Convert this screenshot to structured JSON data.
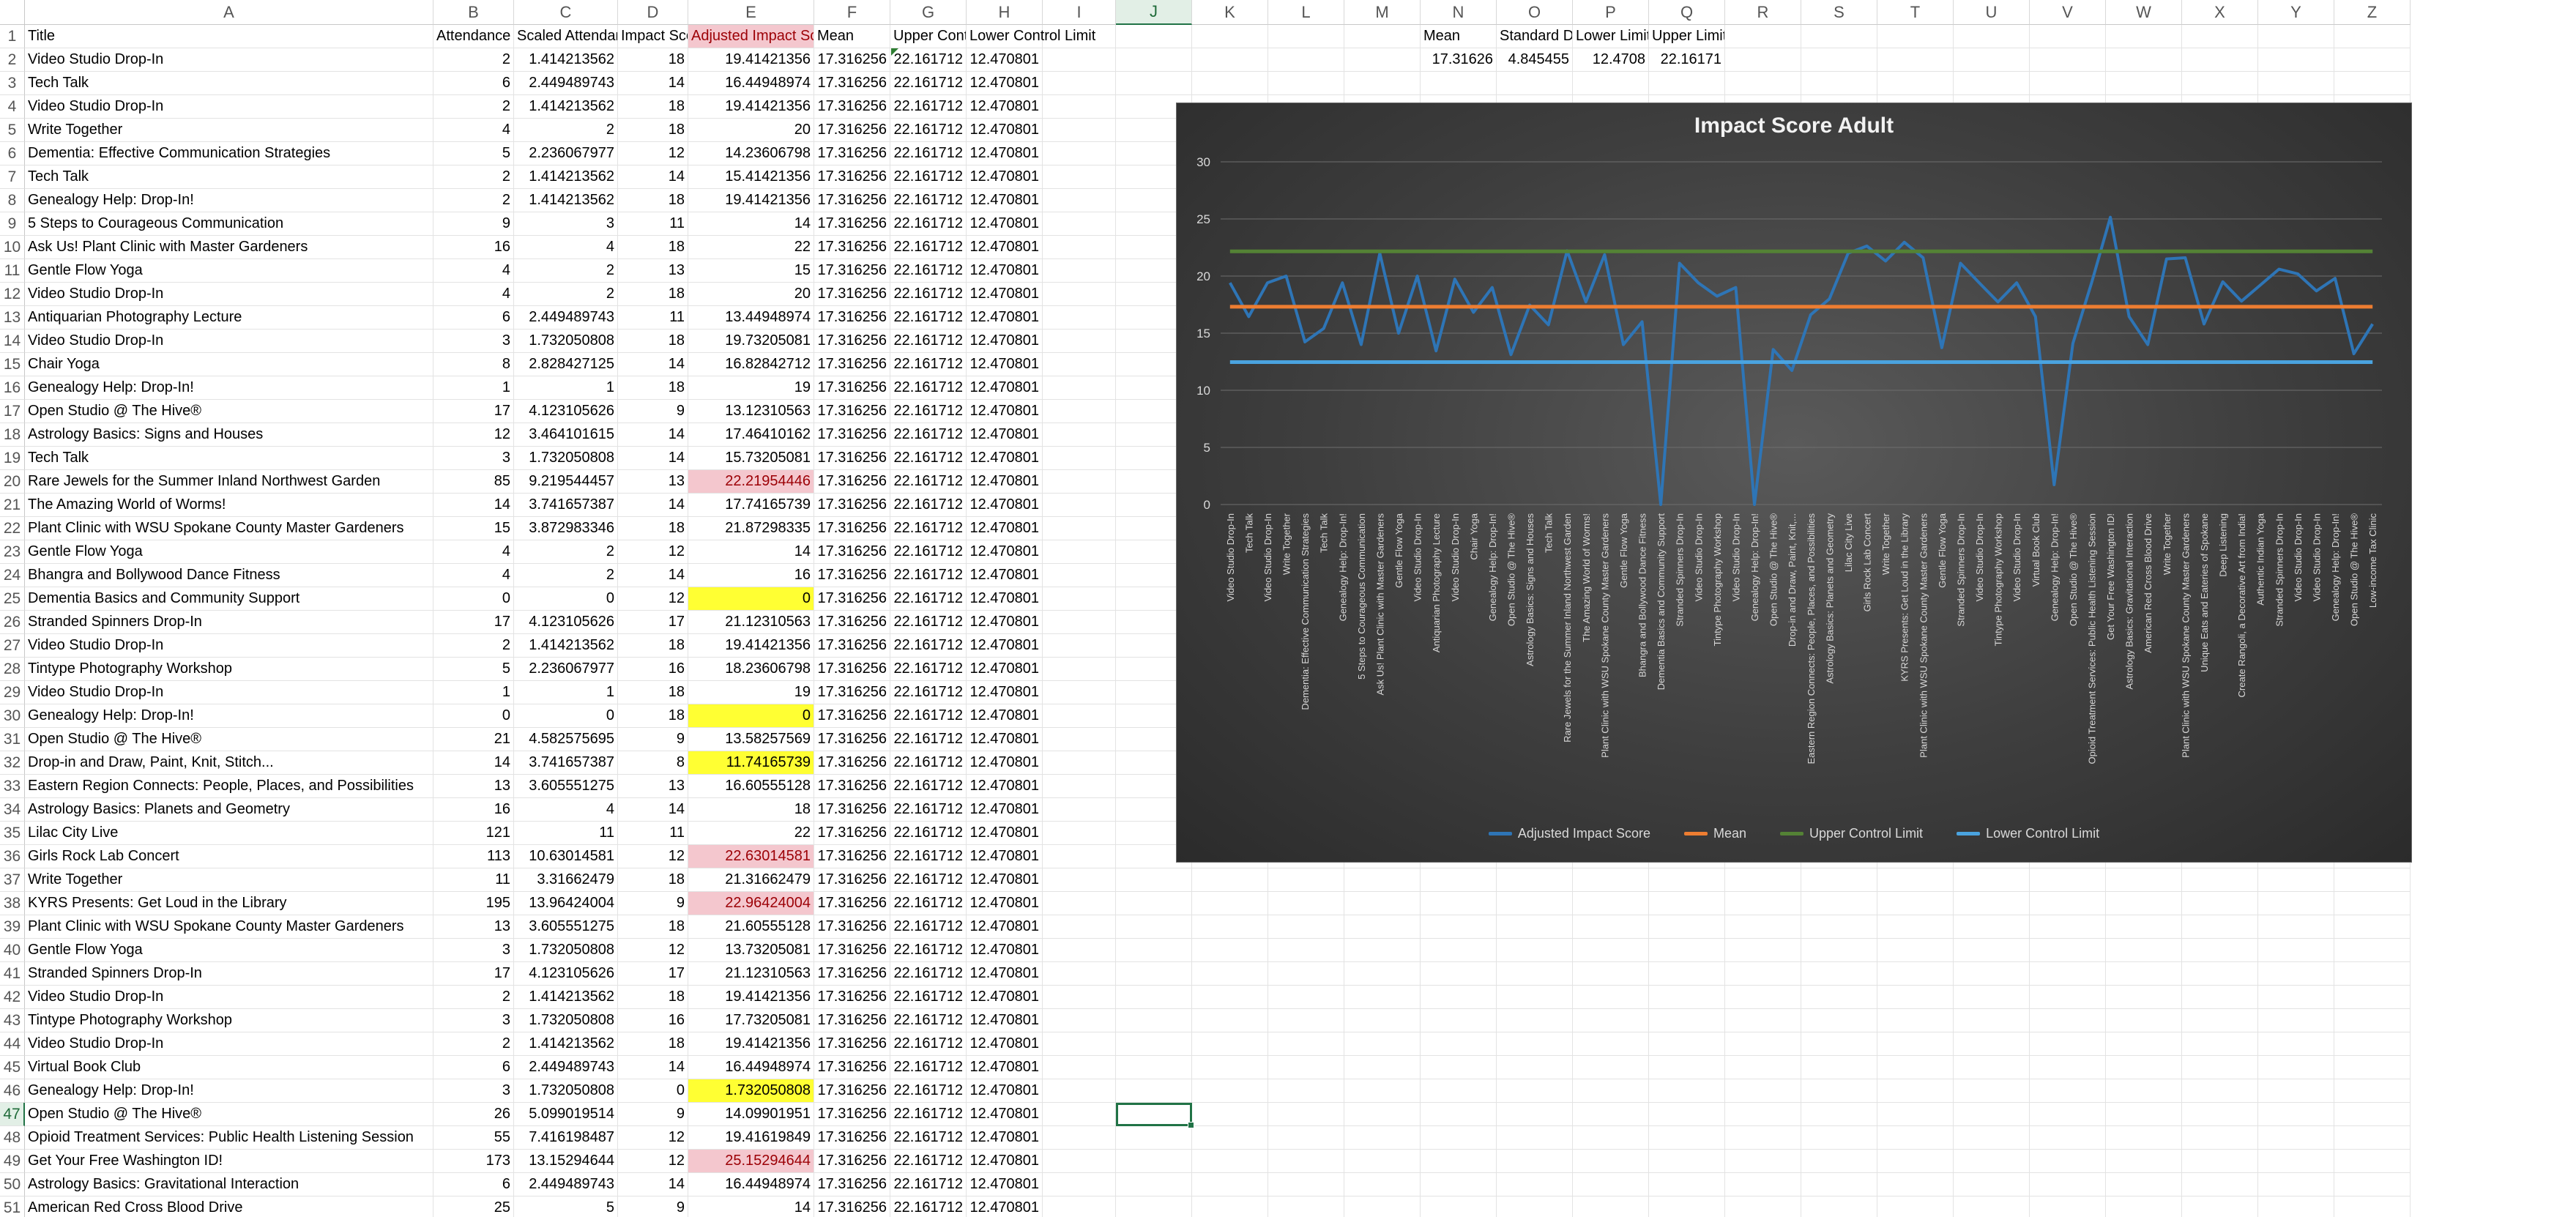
{
  "columns": [
    "A",
    "B",
    "C",
    "D",
    "E",
    "F",
    "G",
    "H",
    "I",
    "J",
    "K",
    "L",
    "M",
    "N",
    "O",
    "P",
    "Q",
    "R",
    "S",
    "T",
    "U",
    "V",
    "W",
    "X",
    "Y",
    "Z"
  ],
  "selected_column": "J",
  "selected_row": "47",
  "headers": {
    "title": "Title",
    "attendance": "Attendance",
    "scaled": "Scaled Attendance",
    "impact": "Impact  Score",
    "adjusted": "Adjusted Impact Score",
    "mean": "Mean",
    "upper": "Upper Control Limit",
    "lower": "Lower Control Limit"
  },
  "rows": [
    {
      "n": "2",
      "title": "Video Studio Drop-In",
      "att": "2",
      "scaled": "1.414213562",
      "impact": "18",
      "adj": "19.41421356",
      "hl": ""
    },
    {
      "n": "3",
      "title": "Tech Talk",
      "att": "6",
      "scaled": "2.449489743",
      "impact": "14",
      "adj": "16.44948974",
      "hl": ""
    },
    {
      "n": "4",
      "title": "Video Studio Drop-In",
      "att": "2",
      "scaled": "1.414213562",
      "impact": "18",
      "adj": "19.41421356",
      "hl": ""
    },
    {
      "n": "5",
      "title": "Write Together",
      "att": "4",
      "scaled": "2",
      "impact": "18",
      "adj": "20",
      "hl": ""
    },
    {
      "n": "6",
      "title": "Dementia: Effective Communication Strategies",
      "att": "5",
      "scaled": "2.236067977",
      "impact": "12",
      "adj": "14.23606798",
      "hl": ""
    },
    {
      "n": "7",
      "title": "Tech Talk",
      "att": "2",
      "scaled": "1.414213562",
      "impact": "14",
      "adj": "15.41421356",
      "hl": ""
    },
    {
      "n": "8",
      "title": "Genealogy Help: Drop-In!",
      "att": "2",
      "scaled": "1.414213562",
      "impact": "18",
      "adj": "19.41421356",
      "hl": ""
    },
    {
      "n": "9",
      "title": "5 Steps to Courageous Communication",
      "att": "9",
      "scaled": "3",
      "impact": "11",
      "adj": "14",
      "hl": ""
    },
    {
      "n": "10",
      "title": "Ask Us! Plant Clinic with Master Gardeners",
      "att": "16",
      "scaled": "4",
      "impact": "18",
      "adj": "22",
      "hl": ""
    },
    {
      "n": "11",
      "title": "Gentle Flow Yoga",
      "att": "4",
      "scaled": "2",
      "impact": "13",
      "adj": "15",
      "hl": ""
    },
    {
      "n": "12",
      "title": "Video Studio Drop-In",
      "att": "4",
      "scaled": "2",
      "impact": "18",
      "adj": "20",
      "hl": ""
    },
    {
      "n": "13",
      "title": "Antiquarian Photography Lecture",
      "att": "6",
      "scaled": "2.449489743",
      "impact": "11",
      "adj": "13.44948974",
      "hl": ""
    },
    {
      "n": "14",
      "title": "Video Studio Drop-In",
      "att": "3",
      "scaled": "1.732050808",
      "impact": "18",
      "adj": "19.73205081",
      "hl": ""
    },
    {
      "n": "15",
      "title": "Chair Yoga",
      "att": "8",
      "scaled": "2.828427125",
      "impact": "14",
      "adj": "16.82842712",
      "hl": ""
    },
    {
      "n": "16",
      "title": "Genealogy Help: Drop-In!",
      "att": "1",
      "scaled": "1",
      "impact": "18",
      "adj": "19",
      "hl": ""
    },
    {
      "n": "17",
      "title": "Open Studio @ The Hive®",
      "att": "17",
      "scaled": "4.123105626",
      "impact": "9",
      "adj": "13.12310563",
      "hl": ""
    },
    {
      "n": "18",
      "title": "Astrology Basics: Signs and Houses",
      "att": "12",
      "scaled": "3.464101615",
      "impact": "14",
      "adj": "17.46410162",
      "hl": ""
    },
    {
      "n": "19",
      "title": "Tech Talk",
      "att": "3",
      "scaled": "1.732050808",
      "impact": "14",
      "adj": "15.73205081",
      "hl": ""
    },
    {
      "n": "20",
      "title": "Rare Jewels for the Summer Inland Northwest Garden",
      "att": "85",
      "scaled": "9.219544457",
      "impact": "13",
      "adj": "22.21954446",
      "hl": "red"
    },
    {
      "n": "21",
      "title": "The Amazing World of Worms!",
      "att": "14",
      "scaled": "3.741657387",
      "impact": "14",
      "adj": "17.74165739",
      "hl": ""
    },
    {
      "n": "22",
      "title": "Plant Clinic with WSU Spokane County Master Gardeners",
      "att": "15",
      "scaled": "3.872983346",
      "impact": "18",
      "adj": "21.87298335",
      "hl": ""
    },
    {
      "n": "23",
      "title": "Gentle Flow Yoga",
      "att": "4",
      "scaled": "2",
      "impact": "12",
      "adj": "14",
      "hl": ""
    },
    {
      "n": "24",
      "title": "Bhangra and Bollywood Dance Fitness",
      "att": "4",
      "scaled": "2",
      "impact": "14",
      "adj": "16",
      "hl": ""
    },
    {
      "n": "25",
      "title": "Dementia Basics and Community Support",
      "att": "0",
      "scaled": "0",
      "impact": "12",
      "adj": "0",
      "hl": "yellow"
    },
    {
      "n": "26",
      "title": "Stranded Spinners Drop-In",
      "att": "17",
      "scaled": "4.123105626",
      "impact": "17",
      "adj": "21.12310563",
      "hl": ""
    },
    {
      "n": "27",
      "title": "Video Studio Drop-In",
      "att": "2",
      "scaled": "1.414213562",
      "impact": "18",
      "adj": "19.41421356",
      "hl": ""
    },
    {
      "n": "28",
      "title": "Tintype Photography Workshop",
      "att": "5",
      "scaled": "2.236067977",
      "impact": "16",
      "adj": "18.23606798",
      "hl": ""
    },
    {
      "n": "29",
      "title": "Video Studio Drop-In",
      "att": "1",
      "scaled": "1",
      "impact": "18",
      "adj": "19",
      "hl": ""
    },
    {
      "n": "30",
      "title": "Genealogy Help: Drop-In!",
      "att": "0",
      "scaled": "0",
      "impact": "18",
      "adj": "0",
      "hl": "yellow"
    },
    {
      "n": "31",
      "title": "Open Studio @ The Hive®",
      "att": "21",
      "scaled": "4.582575695",
      "impact": "9",
      "adj": "13.58257569",
      "hl": ""
    },
    {
      "n": "32",
      "title": "Drop-in and Draw, Paint, Knit, Stitch...",
      "att": "14",
      "scaled": "3.741657387",
      "impact": "8",
      "adj": "11.74165739",
      "hl": "yellow"
    },
    {
      "n": "33",
      "title": "Eastern Region Connects: People, Places, and Possibilities",
      "att": "13",
      "scaled": "3.605551275",
      "impact": "13",
      "adj": "16.60555128",
      "hl": ""
    },
    {
      "n": "34",
      "title": "Astrology Basics: Planets and Geometry",
      "att": "16",
      "scaled": "4",
      "impact": "14",
      "adj": "18",
      "hl": ""
    },
    {
      "n": "35",
      "title": "Lilac City Live",
      "att": "121",
      "scaled": "11",
      "impact": "11",
      "adj": "22",
      "hl": ""
    },
    {
      "n": "36",
      "title": "Girls Rock Lab Concert",
      "att": "113",
      "scaled": "10.63014581",
      "impact": "12",
      "adj": "22.63014581",
      "hl": "red"
    },
    {
      "n": "37",
      "title": "Write Together",
      "att": "11",
      "scaled": "3.31662479",
      "impact": "18",
      "adj": "21.31662479",
      "hl": ""
    },
    {
      "n": "38",
      "title": "KYRS Presents: Get Loud in the Library",
      "att": "195",
      "scaled": "13.96424004",
      "impact": "9",
      "adj": "22.96424004",
      "hl": "red"
    },
    {
      "n": "39",
      "title": "Plant Clinic with WSU Spokane County Master Gardeners",
      "att": "13",
      "scaled": "3.605551275",
      "impact": "18",
      "adj": "21.60555128",
      "hl": ""
    },
    {
      "n": "40",
      "title": "Gentle Flow Yoga",
      "att": "3",
      "scaled": "1.732050808",
      "impact": "12",
      "adj": "13.73205081",
      "hl": ""
    },
    {
      "n": "41",
      "title": "Stranded Spinners Drop-In",
      "att": "17",
      "scaled": "4.123105626",
      "impact": "17",
      "adj": "21.12310563",
      "hl": ""
    },
    {
      "n": "42",
      "title": "Video Studio Drop-In",
      "att": "2",
      "scaled": "1.414213562",
      "impact": "18",
      "adj": "19.41421356",
      "hl": ""
    },
    {
      "n": "43",
      "title": "Tintype Photography Workshop",
      "att": "3",
      "scaled": "1.732050808",
      "impact": "16",
      "adj": "17.73205081",
      "hl": ""
    },
    {
      "n": "44",
      "title": "Video Studio Drop-In",
      "att": "2",
      "scaled": "1.414213562",
      "impact": "18",
      "adj": "19.41421356",
      "hl": ""
    },
    {
      "n": "45",
      "title": "Virtual Book Club",
      "att": "6",
      "scaled": "2.449489743",
      "impact": "14",
      "adj": "16.44948974",
      "hl": ""
    },
    {
      "n": "46",
      "title": "Genealogy Help: Drop-In!",
      "att": "3",
      "scaled": "1.732050808",
      "impact": "0",
      "adj": "1.732050808",
      "hl": "yellow"
    },
    {
      "n": "47",
      "title": "Open Studio @ The Hive®",
      "att": "26",
      "scaled": "5.099019514",
      "impact": "9",
      "adj": "14.09901951",
      "hl": ""
    },
    {
      "n": "48",
      "title": "Opioid Treatment Services: Public Health Listening Session",
      "att": "55",
      "scaled": "7.416198487",
      "impact": "12",
      "adj": "19.41619849",
      "hl": ""
    },
    {
      "n": "49",
      "title": "Get Your Free Washington ID!",
      "att": "173",
      "scaled": "13.15294644",
      "impact": "12",
      "adj": "25.15294644",
      "hl": "red"
    },
    {
      "n": "50",
      "title": "Astrology Basics: Gravitational Interaction",
      "att": "6",
      "scaled": "2.449489743",
      "impact": "14",
      "adj": "16.44948974",
      "hl": ""
    },
    {
      "n": "51",
      "title": "American Red Cross Blood Drive",
      "att": "25",
      "scaled": "5",
      "impact": "9",
      "adj": "14",
      "hl": ""
    }
  ],
  "const": {
    "mean": "17.316256",
    "ucl": "22.161712",
    "lcl": "12.470801"
  },
  "stats": {
    "headers": [
      "Mean",
      "Standard Deviation",
      "Lower Limit",
      "Upper Limit"
    ],
    "values": [
      "17.31626",
      "4.845455",
      "12.4708",
      "22.16171"
    ]
  },
  "colors": {
    "adjusted": "#2e75b6",
    "mean": "#ed7d31",
    "ucl": "#548235",
    "lcl": "#4aa3df"
  },
  "chart_data": {
    "type": "line",
    "title": "Impact Score Adult",
    "ylim": [
      0,
      30
    ],
    "yticks": [
      "0",
      "5",
      "10",
      "15",
      "20",
      "25",
      "30"
    ],
    "categories": [
      "Video Studio Drop-In",
      "Tech Talk",
      "Video Studio Drop-In",
      "Write Together",
      "Dementia: Effective Communication Strategies",
      "Tech Talk",
      "Genealogy Help: Drop-In!",
      "5 Steps to Courageous Communication",
      "Ask Us! Plant Clinic with Master Gardeners",
      "Gentle Flow Yoga",
      "Video Studio Drop-In",
      "Antiquarian Photography Lecture",
      "Video Studio Drop-In",
      "Chair Yoga",
      "Genealogy Help: Drop-In!",
      "Open Studio @ The Hive®",
      "Astrology Basics: Signs and Houses",
      "Tech Talk",
      "Rare Jewels for the Summer Inland Northwest Garden",
      "The Amazing World of Worms!",
      "Plant Clinic with WSU Spokane County Master Gardeners",
      "Gentle Flow Yoga",
      "Bhangra and Bollywood Dance Fitness",
      "Dementia Basics and Community Support",
      "Stranded Spinners Drop-In",
      "Video Studio Drop-In",
      "Tintype Photography Workshop",
      "Video Studio Drop-In",
      "Genealogy Help: Drop-In!",
      "Open Studio @ The Hive®",
      "Drop-in and Draw, Paint, Knit,...",
      "Eastern Region Connects: People, Places, and Possibilities",
      "Astrology Basics: Planets and Geometry",
      "Lilac City Live",
      "Girls Rock Lab Concert",
      "Write Together",
      "KYRS Presents: Get Loud in the Library",
      "Plant Clinic with WSU Spokane County Master Gardeners",
      "Gentle Flow Yoga",
      "Stranded Spinners Drop-In",
      "Video Studio Drop-In",
      "Tintype Photography Workshop",
      "Video Studio Drop-In",
      "Virtual Book Club",
      "Genealogy Help: Drop-In!",
      "Open Studio @ The Hive®",
      "Opioid Treatment Services: Public Health Listening Session",
      "Get Your Free Washington ID!",
      "Astrology Basics: Gravitational Interaction",
      "American Red Cross Blood Drive",
      "Write Together",
      "Plant Clinic with WSU Spokane County Master Gardeners",
      "Unique Eats and Eateries of Spokane",
      "Deep Listening",
      "Create Rangoli, a Decorative Art from India!",
      "Authentic Indian Yoga",
      "Stranded Spinners Drop-In",
      "Video Studio Drop-In",
      "Video Studio Drop-In",
      "Genealogy Help: Drop-In!",
      "Open Studio @ The Hive®",
      "Low-income Tax Clinic"
    ],
    "series": [
      {
        "name": "Adjusted Impact Score",
        "values": [
          19.41,
          16.45,
          19.41,
          20,
          14.24,
          15.41,
          19.41,
          14,
          22,
          15,
          20,
          13.45,
          19.73,
          16.83,
          19,
          13.12,
          17.46,
          15.73,
          22.22,
          17.74,
          21.87,
          14,
          16,
          0,
          21.12,
          19.41,
          18.24,
          19,
          0,
          13.58,
          11.74,
          16.61,
          18,
          22,
          22.63,
          21.32,
          22.96,
          21.61,
          13.73,
          21.12,
          19.41,
          17.73,
          19.41,
          16.45,
          1.73,
          14.1,
          19.42,
          25.15,
          16.45,
          14,
          21.5,
          21.6,
          15.8,
          19.5,
          17.8,
          19.2,
          20.6,
          20.2,
          18.7,
          19.8,
          13.2,
          15.8
        ]
      },
      {
        "name": "Mean",
        "values": "const:17.316256"
      },
      {
        "name": "Upper Control Limit",
        "values": "const:22.161712"
      },
      {
        "name": "Lower Control Limit",
        "values": "const:12.470801"
      }
    ],
    "legend_position": "bottom"
  }
}
